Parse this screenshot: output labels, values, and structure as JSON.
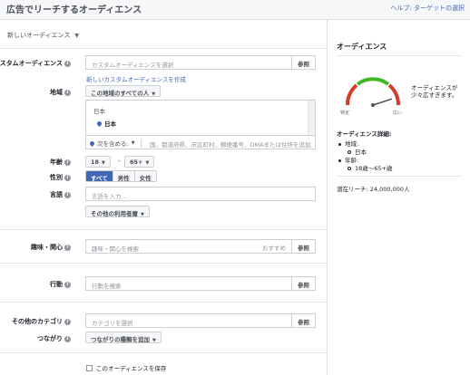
{
  "header": {
    "title": "広告でリーチするオーディエンス",
    "help_link": "ヘルプ: ターゲットの選択"
  },
  "audience_selector": {
    "label": "新しいオーディエンス"
  },
  "custom_audience": {
    "label": "カスタムオーディエンス",
    "placeholder": "カスタムオーディエンスを選択",
    "browse": "参照",
    "create_link": "新しいカスタムオーディエンスを作成"
  },
  "location": {
    "label": "地域",
    "dropdown": "この地域のすべての人",
    "country": "日本",
    "selected": "日本",
    "include": "次を含める:",
    "placeholder": "国、都道府県、市区町村、郵便番号、DMAまたは住所を追加"
  },
  "age": {
    "label": "年齢",
    "min": "18",
    "max": "65+",
    "separator": "-"
  },
  "gender": {
    "label": "性別",
    "options": [
      "すべて",
      "男性",
      "女性"
    ],
    "selected": "すべて"
  },
  "language": {
    "label": "言語",
    "placeholder": "言語を入力...",
    "more_button": "その他の利用者層"
  },
  "interests": {
    "label": "趣味・関心",
    "placeholder": "趣味・関心を検索",
    "suggestions": "おすすめ",
    "browse": "参照"
  },
  "behaviors": {
    "label": "行動",
    "placeholder": "行動を検索",
    "browse": "参照"
  },
  "more_categories": {
    "label": "その他のカテゴリ",
    "placeholder": "カテゴリを選択",
    "browse": "参照"
  },
  "connections": {
    "label": "つながり",
    "dropdown": "つながりの種類を追加"
  },
  "save_audience": {
    "label": "このオーディエンスを保存",
    "checked": false
  },
  "sidebar": {
    "title": "オーディエンス",
    "gauge": {
      "left_label": "特定",
      "right_label": "広い",
      "level": 0.9
    },
    "gauge_text": "オーディエンスが少々広すぎます。",
    "details_title": "オーディエンス詳細:",
    "details": {
      "location_label": "地域:",
      "location_value": "日本",
      "age_label": "年齢:",
      "age_value": "18歳〜65+歳"
    },
    "potential_reach": "潜在リーチ: 24,000,000人"
  },
  "colors": {
    "accent": "#4267b2",
    "gauge_red": "#d13c2b",
    "gauge_yellow": "#f2c11c",
    "gauge_green": "#42b72a"
  }
}
